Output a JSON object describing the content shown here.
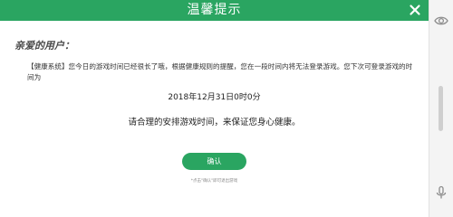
{
  "dialog": {
    "title": "温馨提示",
    "greeting": "亲爱的用户：",
    "notice": "【健康系统】您今日的游戏时间已经很长了哦，根据健康规则的提醒，您在一段时间内将无法登录游戏。您下次可登录游戏的时间为",
    "unlock_time": "2018年12月31日0时0分",
    "advice": "请合理的安排游戏时间，来保证您身心健康。",
    "confirm_label": "确认",
    "hint": "*点击\"确认\"即可退出游戏"
  },
  "colors": {
    "accent": "#2aa561",
    "text": "#333333",
    "hint": "#8a8a8a"
  },
  "icons": {
    "close": "close-icon",
    "sidebar_top": "eye-icon",
    "sidebar_bottom": "microphone-icon"
  }
}
